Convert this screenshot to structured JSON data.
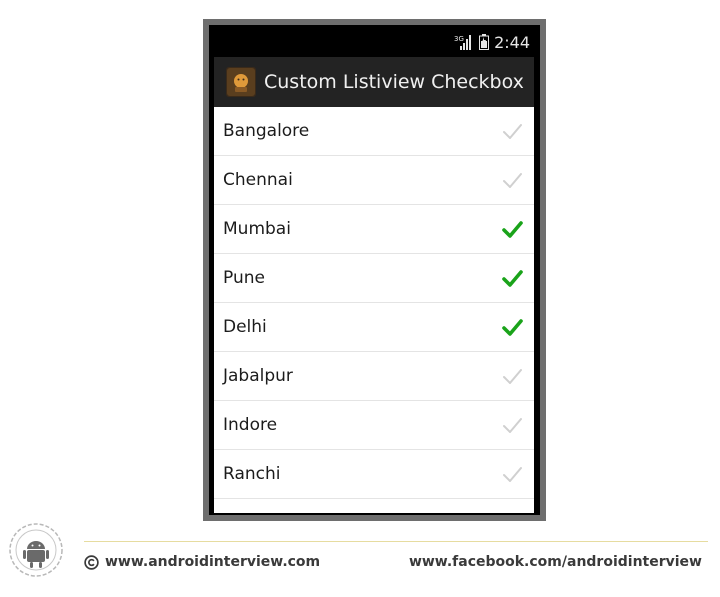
{
  "status_bar": {
    "time": "2:44",
    "network": "3G"
  },
  "action_bar": {
    "title": "Custom Listiview Checkbox",
    "icon": "android-app-icon"
  },
  "list": {
    "items": [
      {
        "label": "Bangalore",
        "checked": false
      },
      {
        "label": "Chennai",
        "checked": false
      },
      {
        "label": "Mumbai",
        "checked": true
      },
      {
        "label": "Pune",
        "checked": true
      },
      {
        "label": "Delhi",
        "checked": true
      },
      {
        "label": "Jabalpur",
        "checked": false
      },
      {
        "label": "Indore",
        "checked": false
      },
      {
        "label": "Ranchi",
        "checked": false
      },
      {
        "label": "",
        "checked": false
      }
    ]
  },
  "footer": {
    "left_text": "www.androidinterview.com",
    "right_text": "www.facebook.com/androidinterview",
    "logo": "android-logo-icon"
  },
  "colors": {
    "check_on": "#1aa31a",
    "check_off": "#d0d0d0",
    "action_bar": "#232323"
  }
}
